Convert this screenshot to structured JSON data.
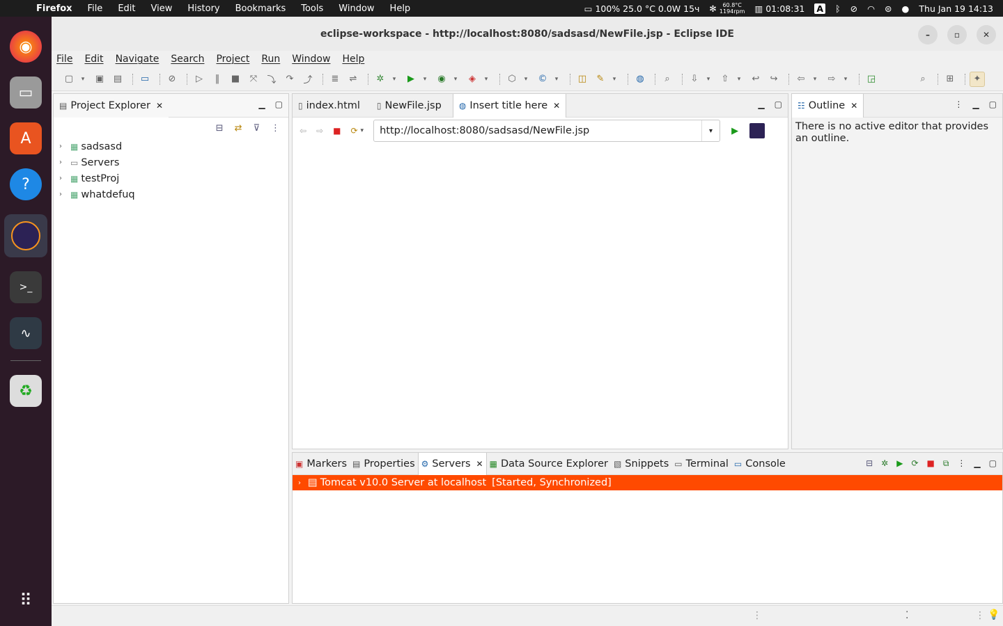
{
  "topbar": {
    "app_name": "Firefox",
    "menus": [
      "File",
      "Edit",
      "View",
      "History",
      "Bookmarks",
      "Tools",
      "Window",
      "Help"
    ],
    "battery": "100% 25.0 °C 0.0W 15ч",
    "cpu_temp": "60.8°C",
    "cpu_rpm": "1194rpm",
    "timer": "01:08:31",
    "keyboard": "A",
    "datetime": "Thu Jan 19  14:13"
  },
  "dock": {
    "apps": [
      "firefox-icon",
      "files-icon",
      "app-center-icon",
      "help-icon",
      "eclipse-icon",
      "terminal-icon",
      "system-monitor-icon",
      "trash-icon",
      "show-apps-icon"
    ]
  },
  "window": {
    "title": "eclipse-workspace - http://localhost:8080/sadsasd/NewFile.jsp - Eclipse IDE"
  },
  "menubar": [
    "File",
    "Edit",
    "Navigate",
    "Search",
    "Project",
    "Run",
    "Window",
    "Help"
  ],
  "project_explorer": {
    "tab_label": "Project Explorer",
    "items": [
      "sadsasd",
      "Servers",
      "testProj",
      "whatdefuq"
    ]
  },
  "editor": {
    "tabs": [
      "index.html",
      "NewFile.jsp",
      "Insert title here"
    ],
    "url": "http://localhost:8080/sadsasd/NewFile.jsp"
  },
  "outline": {
    "tab_label": "Outline",
    "message": "There is no active editor that provides an outline."
  },
  "bottom_panel": {
    "tabs": [
      "Markers",
      "Properties",
      "Servers",
      "Data Source Explorer",
      "Snippets",
      "Terminal",
      "Console"
    ],
    "server_name": "Tomcat v10.0 Server at localhost",
    "server_status": "[Started, Synchronized]",
    "highlight_color": "#ff4a00"
  }
}
